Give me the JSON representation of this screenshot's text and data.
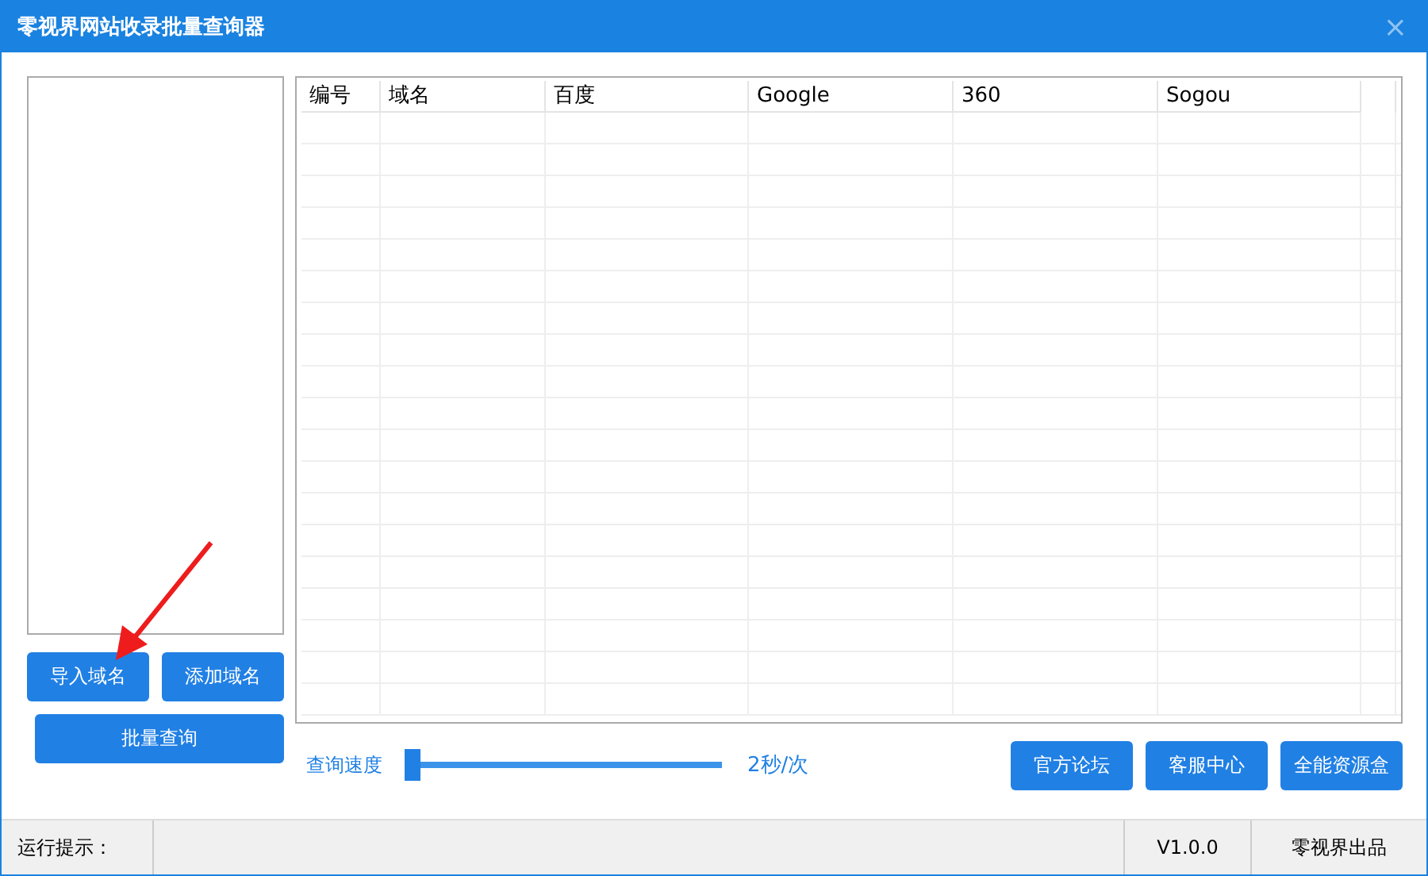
{
  "window": {
    "title": "零视界网站收录批量查询器",
    "close": "×"
  },
  "left_buttons": [
    "导入域名",
    "添加域名"
  ],
  "query_button": "批量查询",
  "table": {
    "columns": [
      "编号",
      "域名",
      "百度",
      "Google",
      "360",
      "Sogou"
    ]
  },
  "speed": {
    "label": "查询速度",
    "level": 0,
    "reading": "2秒/次"
  },
  "link_buttons": [
    "官方论坛",
    "客服中心",
    "全能资源盒"
  ],
  "status_bar": {
    "hint": "运行提示：",
    "version": "V1.0.0",
    "maker": "零视界出品"
  }
}
